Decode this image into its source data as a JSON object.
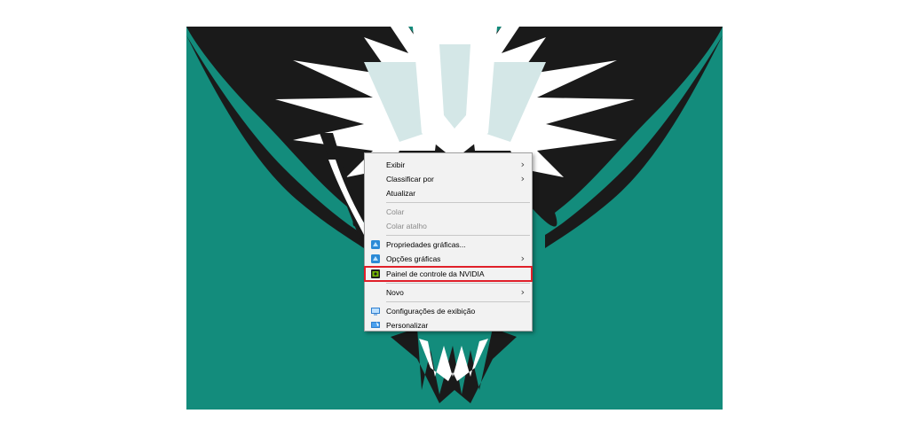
{
  "context_menu": {
    "items": [
      {
        "label": "Exibir",
        "submenu": true
      },
      {
        "label": "Classificar por",
        "submenu": true
      },
      {
        "label": "Atualizar"
      },
      {
        "label": "Colar",
        "disabled": true
      },
      {
        "label": "Colar atalho",
        "disabled": true
      },
      {
        "label": "Propriedades gráficas...",
        "icon": "intel-graphics-icon"
      },
      {
        "label": "Opções gráficas",
        "icon": "intel-graphics-icon",
        "submenu": true
      },
      {
        "label": "Painel de controle da NVIDIA",
        "icon": "nvidia-icon",
        "highlighted": true
      },
      {
        "label": "Novo",
        "submenu": true
      },
      {
        "label": "Configurações de exibição",
        "icon": "display-settings-icon"
      },
      {
        "label": "Personalizar",
        "icon": "personalize-icon"
      }
    ]
  },
  "colors": {
    "desktop_bg": "#138c7c",
    "highlight_border": "#e0202a"
  }
}
